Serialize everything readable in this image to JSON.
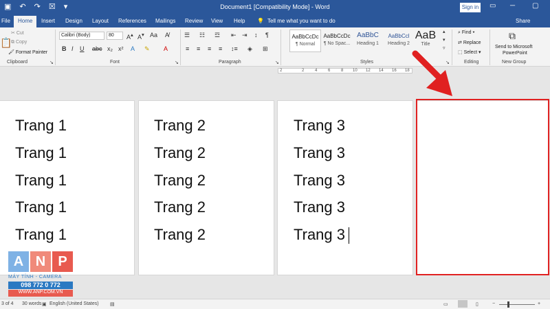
{
  "window": {
    "title": "Document1 [Compatibility Mode] - Word",
    "sign_in": "Sign in",
    "share": "Share"
  },
  "tabs": [
    {
      "label": "File"
    },
    {
      "label": "Home"
    },
    {
      "label": "Insert"
    },
    {
      "label": "Design"
    },
    {
      "label": "Layout"
    },
    {
      "label": "References"
    },
    {
      "label": "Mailings"
    },
    {
      "label": "Review"
    },
    {
      "label": "View"
    },
    {
      "label": "Help"
    }
  ],
  "tell_me": "Tell me what you want to do",
  "clipboard": {
    "cut": "Cut",
    "copy": "Copy",
    "format_painter": "Format Painter",
    "group": "Clipboard"
  },
  "font": {
    "name": "Calibri (Body)",
    "size": "80",
    "group": "Font"
  },
  "paragraph": {
    "group": "Paragraph"
  },
  "styles": {
    "items": [
      {
        "preview": "AaBbCcDc",
        "name": "¶ Normal"
      },
      {
        "preview": "AaBbCcDc",
        "name": "¶ No Spac..."
      },
      {
        "preview": "AaBbC",
        "name": "Heading 1"
      },
      {
        "preview": "AaBbCcl",
        "name": "Heading 2"
      },
      {
        "preview": "AaB",
        "name": "Title"
      }
    ],
    "group": "Styles"
  },
  "editing": {
    "find": "Find",
    "replace": "Replace",
    "select": "Select",
    "group": "Editing"
  },
  "new_group": {
    "send": "Send to Microsoft",
    "send2": "PowerPoint",
    "group": "New Group"
  },
  "ruler": {
    "ticks": [
      "2",
      "2",
      "4",
      "6",
      "8",
      "10",
      "12",
      "14",
      "16",
      "18"
    ]
  },
  "pages": [
    {
      "lines": [
        "Trang 1",
        "Trang 1",
        "Trang 1",
        "Trang 1",
        "Trang 1"
      ]
    },
    {
      "lines": [
        "Trang 2",
        "Trang 2",
        "Trang 2",
        "Trang 2",
        "Trang 2"
      ]
    },
    {
      "lines": [
        "Trang 3",
        "Trang 3",
        "Trang 3",
        "Trang 3",
        "Trang 3"
      ]
    },
    {
      "lines": []
    }
  ],
  "watermark": {
    "letters": [
      "A",
      "N",
      "P"
    ],
    "tagline": "MÁY TÍNH - CAMERA",
    "phone": "098 772 0 772",
    "site": "WWW.ANP.COM.VN"
  },
  "status": {
    "page": "3 of 4",
    "words": "30 words",
    "language": "English (United States)"
  },
  "colors": {
    "accent": "#2b579a",
    "annotation": "#e02020",
    "logo_a": "#7fb2e5",
    "logo_n": "#f08a7a",
    "logo_p": "#e85a4f"
  }
}
